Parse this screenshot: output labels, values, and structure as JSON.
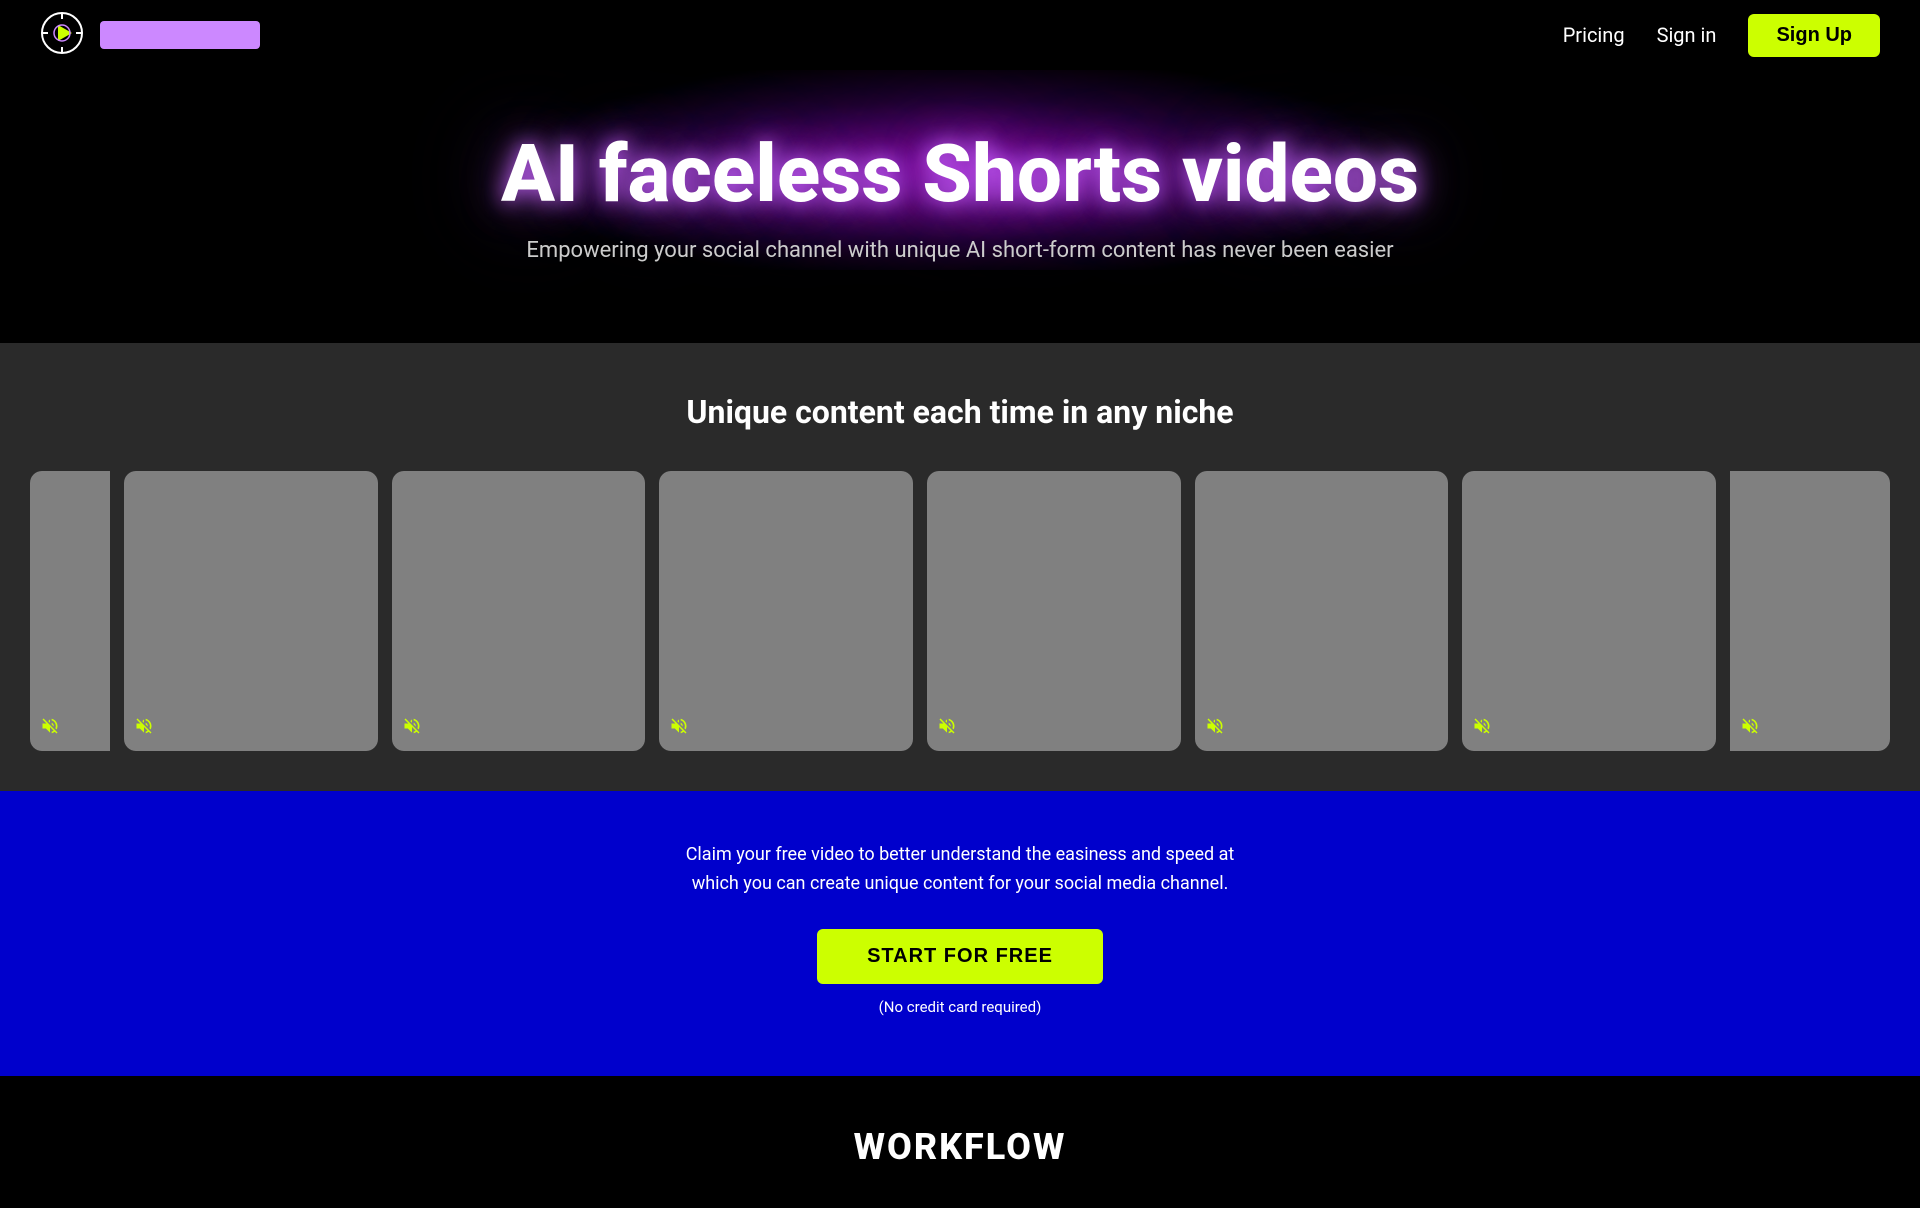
{
  "navbar": {
    "logo_placeholder_color": "#cc88ff",
    "links": [
      {
        "label": "Pricing",
        "id": "pricing-link"
      },
      {
        "label": "Sign in",
        "id": "signin-link"
      }
    ],
    "signup_label": "Sign Up"
  },
  "hero": {
    "title": "AI faceless Shorts videos",
    "subtitle": "Empowering your social channel with unique AI short-form content has never been easier"
  },
  "content_section": {
    "title": "Unique content each time in any niche",
    "video_cards": [
      {
        "id": "card-1",
        "muted": true
      },
      {
        "id": "card-2",
        "muted": true
      },
      {
        "id": "card-3",
        "muted": true
      },
      {
        "id": "card-4",
        "muted": true
      },
      {
        "id": "card-5",
        "muted": true
      },
      {
        "id": "card-6",
        "muted": true
      },
      {
        "id": "card-7",
        "muted": true
      },
      {
        "id": "card-8",
        "muted": true
      }
    ]
  },
  "cta_section": {
    "text_line1": "Claim your free video to better understand the easiness and speed at",
    "text_line2": "which you can create unique content for your social media channel.",
    "button_label": "START FOR FREE",
    "note": "(No credit card required)"
  },
  "workflow_section": {
    "title": "WORKFLOW"
  }
}
